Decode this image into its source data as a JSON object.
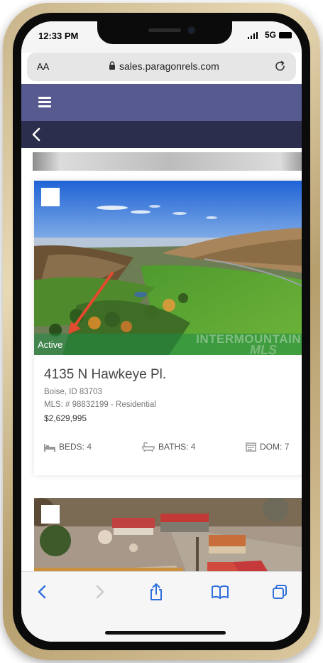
{
  "status_bar": {
    "time": "12:33 PM",
    "network": "5G"
  },
  "browser": {
    "text_size_label": "AA",
    "url": "sales.paragonrels.com"
  },
  "colors": {
    "nav_bar": "#565a8f",
    "sub_bar": "#2b2e4c",
    "ios_blue": "#2f6fdc",
    "status_active": "#1e8c46"
  },
  "listings": [
    {
      "status": "Active",
      "watermark_line1": "INTERMOUNTAIN",
      "watermark_line2": "MLS",
      "address": "4135 N Hawkeye Pl.",
      "city_zip": "Boise, ID 83703",
      "mls": "MLS: # 98832199 - Residential",
      "price": "$2,629,995",
      "beds_label": "BEDS:",
      "beds": "4",
      "baths_label": "BATHS:",
      "baths": "4",
      "dom_label": "DOM:",
      "dom": "7"
    }
  ],
  "icons": {
    "menu": "hamburger-icon",
    "back": "chevron-left-icon",
    "lock": "lock-icon",
    "reload": "reload-icon",
    "beds": "bed-icon",
    "baths": "bathtub-icon",
    "dom": "calendar-icon",
    "toolbar": [
      "back-arrow-icon",
      "forward-arrow-icon",
      "share-icon",
      "bookmarks-icon",
      "tabs-icon"
    ]
  }
}
